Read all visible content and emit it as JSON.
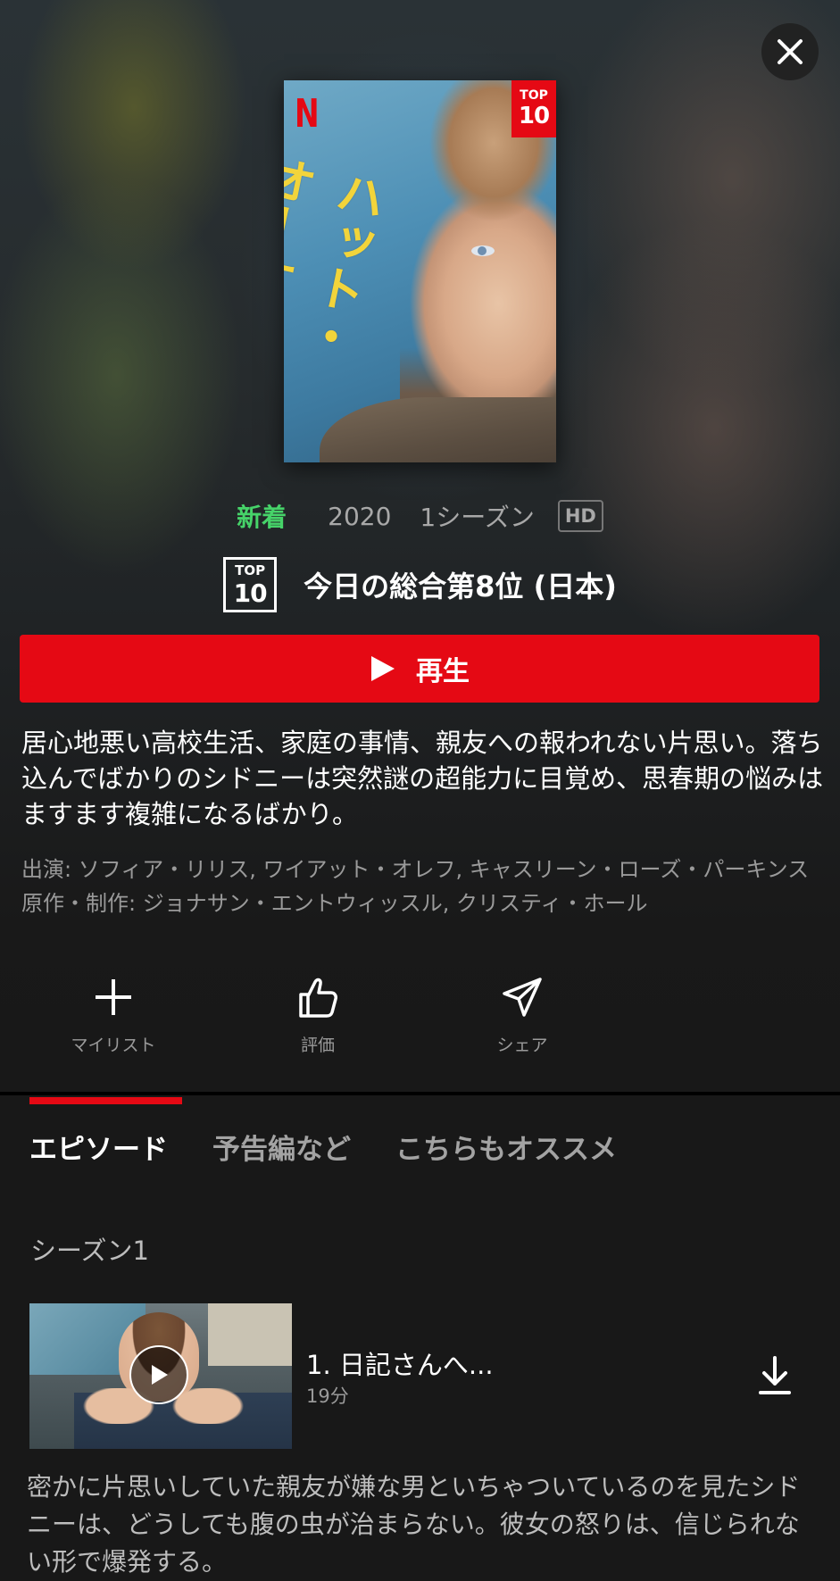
{
  "close": {
    "icon": "close-icon"
  },
  "poster": {
    "brand_mark": "N",
    "badge_top": "TOP",
    "badge_num": "10",
    "title_art": "ハット・オーケー"
  },
  "meta": {
    "new_label": "新着",
    "year": "2020",
    "seasons": "1シーズン",
    "quality": "HD",
    "new_color": "#46d369"
  },
  "ranking": {
    "badge_top": "TOP",
    "badge_num": "10",
    "text": "今日の総合第8位 (日本)"
  },
  "play_button": {
    "label": "再生",
    "icon": "play-icon",
    "color": "#e50914"
  },
  "synopsis": "居心地悪い高校生活、家庭の事情、親友への報われない片思い。落ち込んでばかりのシドニーは突然謎の超能力に目覚め、思春期の悩みはますます複雑になるばかり。",
  "credits": {
    "cast": "出演: ソフィア・リリス, ワイアット・オレフ, キャスリーン・ローズ・パーキンス",
    "creators": "原作・制作: ジョナサン・エントウィッスル, クリスティ・ホール"
  },
  "actions": [
    {
      "label": "マイリスト",
      "icon": "plus-icon"
    },
    {
      "label": "評価",
      "icon": "thumbs-up-icon"
    },
    {
      "label": "シェア",
      "icon": "share-icon"
    }
  ],
  "tabs": [
    {
      "label": "エピソード",
      "active": true
    },
    {
      "label": "予告編など",
      "active": false
    },
    {
      "label": "こちらもオススメ",
      "active": false
    }
  ],
  "season_label": "シーズン1",
  "episode": {
    "title": "1. 日記さんへ...",
    "duration": "19分",
    "icon_play": "play-circle-icon",
    "icon_download": "download-icon",
    "synopsis": "密かに片思いしていた親友が嫌な男といちゃついているのを見たシドニーは、どうしても腹の虫が治まらない。彼女の怒りは、信じられない形で爆発する。"
  },
  "colors": {
    "accent": "#e50914",
    "background": "#181818"
  }
}
